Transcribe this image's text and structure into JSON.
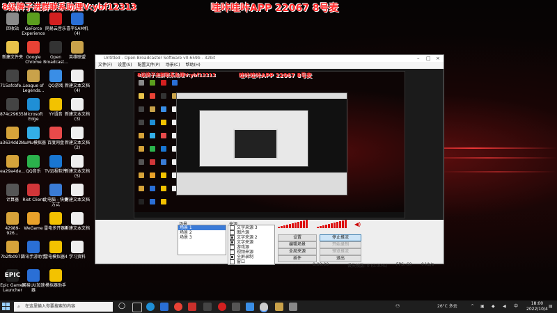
{
  "overlay": {
    "left_text": "8级牌子进群联系助理V:ybf12313",
    "right_text": "哇咔哇咔APP 22067 8号麦"
  },
  "desktop_icons": [
    {
      "label": "回收站",
      "color": "#8a8a8a",
      "glyph": ""
    },
    {
      "label": "GeForce Experience",
      "color": "#5b9e1e",
      "glyph": ""
    },
    {
      "label": "网易云音乐",
      "color": "#d32020",
      "glyph": ""
    },
    {
      "label": "喜平SAM机 (4)",
      "color": "#2a6fd6",
      "glyph": ""
    },
    {
      "label": "新建文件夹",
      "color": "#e8c34a",
      "glyph": ""
    },
    {
      "label": "Google Chrome",
      "color": "#e94235",
      "glyph": ""
    },
    {
      "label": "Open Broadcast...",
      "color": "#333333",
      "glyph": ""
    },
    {
      "label": "英雄联盟",
      "color": "#c9a24a",
      "glyph": ""
    },
    {
      "label": "715afcbfe...",
      "color": "#444444",
      "glyph": ""
    },
    {
      "label": "League of Legends...",
      "color": "#c9a24a",
      "glyph": ""
    },
    {
      "label": "QQ游戏",
      "color": "#3a8ee6",
      "glyph": ""
    },
    {
      "label": "新建文本文档 (4)",
      "color": "#eeeeee",
      "glyph": ""
    },
    {
      "label": "874c29635...",
      "color": "#444444",
      "glyph": ""
    },
    {
      "label": "Microsoft Edge",
      "color": "#1f8fd6",
      "glyph": ""
    },
    {
      "label": "YY语音",
      "color": "#f2c200",
      "glyph": ""
    },
    {
      "label": "新建文本文档 (3)",
      "color": "#eeeeee",
      "glyph": ""
    },
    {
      "label": "a3634dd2...",
      "color": "#d6a33a",
      "glyph": ""
    },
    {
      "label": "MuMu模拟器",
      "color": "#33aee8",
      "glyph": ""
    },
    {
      "label": "百度网盘",
      "color": "#e94a4a",
      "glyph": ""
    },
    {
      "label": "新建文本文档 (2)",
      "color": "#eeeeee",
      "glyph": ""
    },
    {
      "label": "ea29a4de...",
      "color": "#d6a33a",
      "glyph": ""
    },
    {
      "label": "QQ音乐",
      "color": "#2bb24c",
      "glyph": ""
    },
    {
      "label": "TV远程软件",
      "color": "#1976d2",
      "glyph": ""
    },
    {
      "label": "新建文本文档 (5)",
      "color": "#eeeeee",
      "glyph": ""
    },
    {
      "label": "计算器",
      "color": "#555555",
      "glyph": ""
    },
    {
      "label": "Riot Client",
      "color": "#d13639",
      "glyph": ""
    },
    {
      "label": "此电脑 - 快捷方式",
      "color": "#3a7bd5",
      "glyph": ""
    },
    {
      "label": "新建文本文档",
      "color": "#eeeeee",
      "glyph": ""
    },
    {
      "label": "42989-926...",
      "color": "#d6a33a",
      "glyph": ""
    },
    {
      "label": "WeGame",
      "color": "#e8a12a",
      "glyph": ""
    },
    {
      "label": "雷电多开器4",
      "color": "#f3c200",
      "glyph": ""
    },
    {
      "label": "新建文本文档",
      "color": "#eeeeee",
      "glyph": ""
    },
    {
      "label": "7b2fb097...",
      "color": "#d6a33a",
      "glyph": ""
    },
    {
      "label": "腾讯手游助手",
      "color": "#2a6fd6",
      "glyph": ""
    },
    {
      "label": "雷电模拟器4",
      "color": "#f3c200",
      "glyph": ""
    },
    {
      "label": "学习资料",
      "color": "#eeeeee",
      "glyph": ""
    },
    {
      "label": "Epic Games Launcher",
      "color": "#222222",
      "glyph": "EPIC"
    },
    {
      "label": "网易UU加速器",
      "color": "#2a6fd6",
      "glyph": ""
    },
    {
      "label": "模拟器助手",
      "color": "#f3c200",
      "glyph": ""
    }
  ],
  "obs": {
    "title": "Untitled - Open Broadcaster Software v0.659b - 32bit",
    "menu": [
      "文件(F)",
      "设置(S)",
      "配置文件(P)",
      "场景(C)",
      "帮助(H)"
    ],
    "scenes_label": "场景",
    "scenes": [
      "场景 1",
      "场景 2",
      "场景 3"
    ],
    "sources_label": "来源",
    "sources": [
      {
        "label": "文字来源 3",
        "checked": false
      },
      {
        "label": "图片源",
        "checked": false
      },
      {
        "label": "文字来源 2",
        "checked": true
      },
      {
        "label": "文字来源",
        "checked": true
      },
      {
        "label": "游戏源",
        "checked": false
      },
      {
        "label": "视频来源",
        "checked": false
      },
      {
        "label": "全屏录制",
        "checked": true
      },
      {
        "label": "窗口",
        "checked": false
      }
    ],
    "buttons": {
      "settings": "设置",
      "stop_stream": "停止推流",
      "edit_scene": "编辑场景",
      "start_record": "开始录制",
      "global_sources": "全局来源",
      "preview_stream": "预览推流",
      "plugins": "插件",
      "exit": "退出"
    },
    "status": {
      "timer": "0:00:00",
      "fps_label": "FPS: 60",
      "bitrate": "0 kb/s",
      "dropped": "丢失帧数: 0 (0.00%)"
    }
  },
  "taskbar": {
    "search_placeholder": "在这里输入你要搜索的内容",
    "weather": "26°C 多云",
    "time": "18:00",
    "date": "2022/10/4",
    "colors": {
      "start": "#9ad0ff",
      "chrome": "#e94235",
      "edge": "#1f8fd6",
      "obs": "#cccccc"
    }
  }
}
